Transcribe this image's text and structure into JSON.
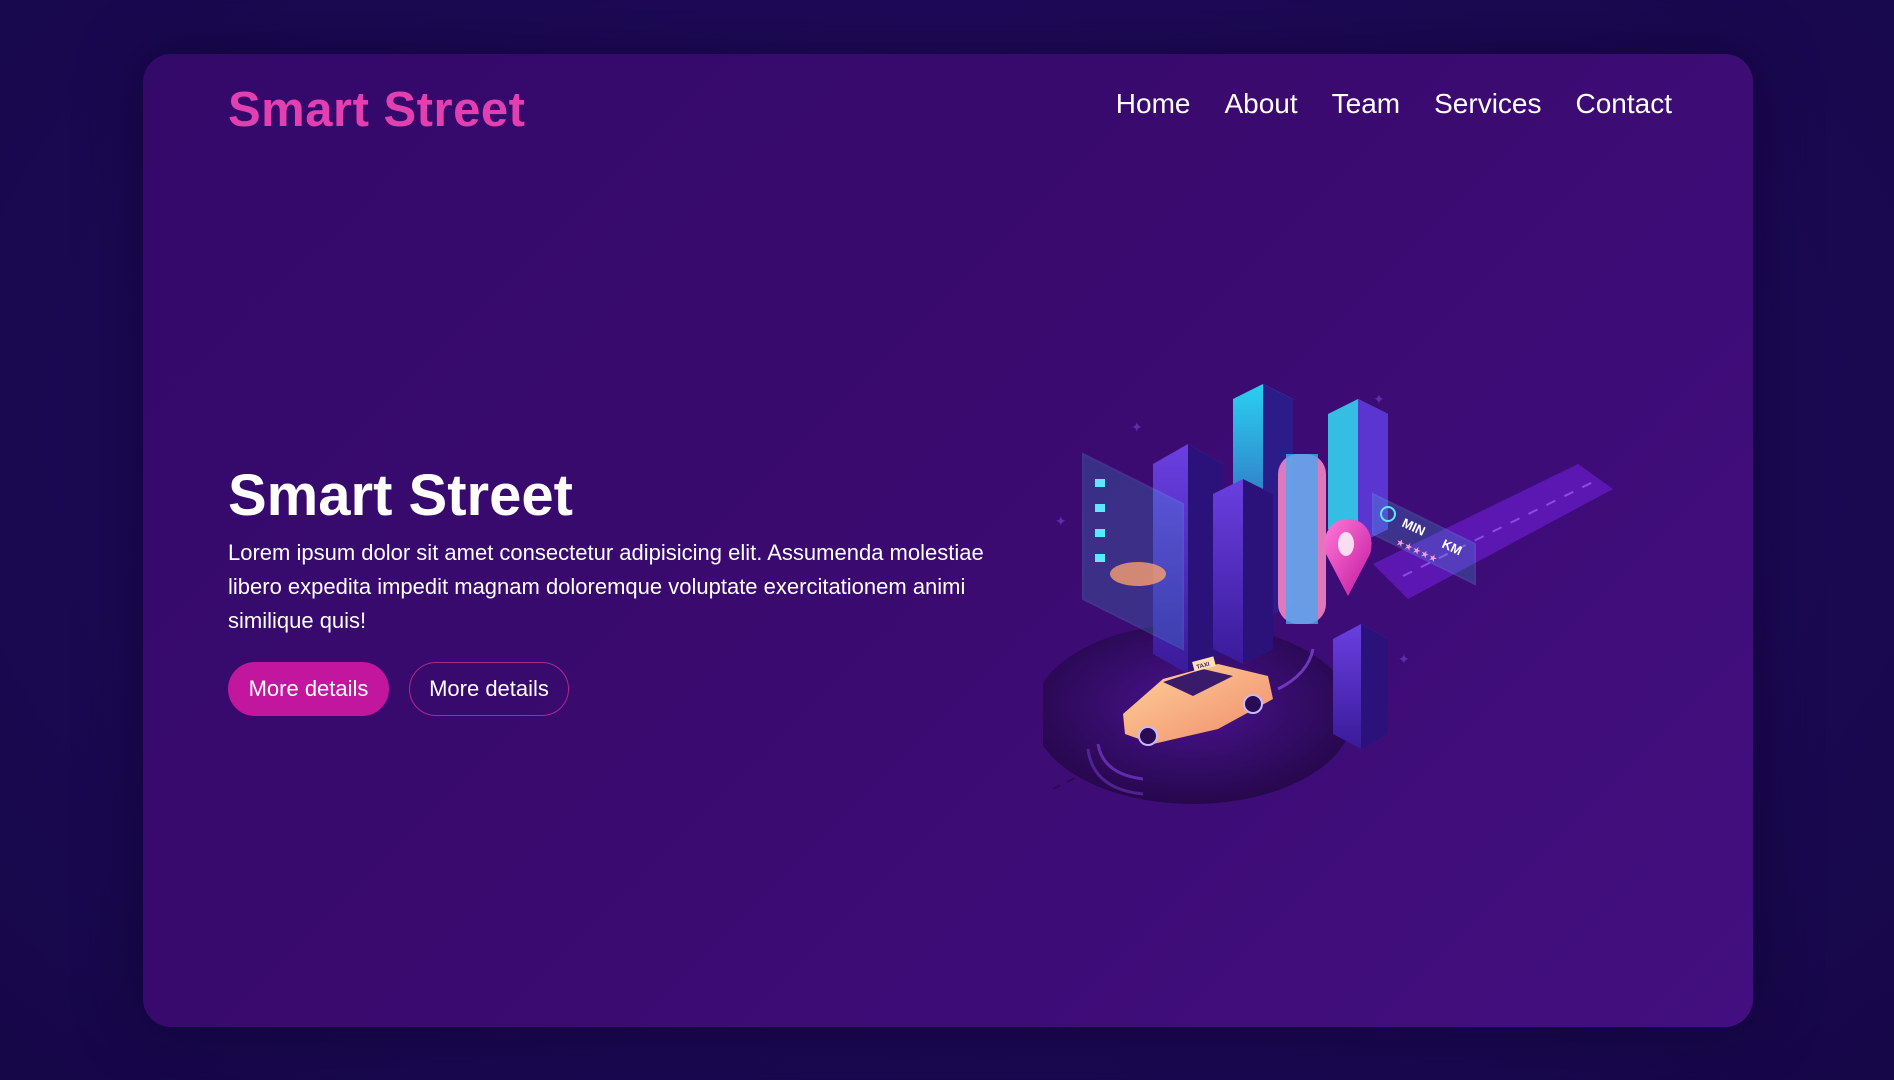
{
  "header": {
    "logo": "Smart Street",
    "nav": [
      {
        "label": "Home"
      },
      {
        "label": "About"
      },
      {
        "label": "Team"
      },
      {
        "label": "Services"
      },
      {
        "label": "Contact"
      }
    ]
  },
  "hero": {
    "title": "Smart Street",
    "text": "Lorem ipsum dolor sit amet consectetur adipisicing elit. Assumenda molestiae libero expedita impedit magnam doloremque voluptate exercitationem animi similique quis!",
    "primary_button": "More details",
    "secondary_button": "More details"
  },
  "illustration": {
    "panel_min": "MIN",
    "panel_km": "KM",
    "taxi_sign": "TAXI"
  },
  "colors": {
    "accent": "#e23fb0",
    "button": "#c2169e",
    "card_bg": "#3a0a6f",
    "page_bg": "#1c0955"
  }
}
